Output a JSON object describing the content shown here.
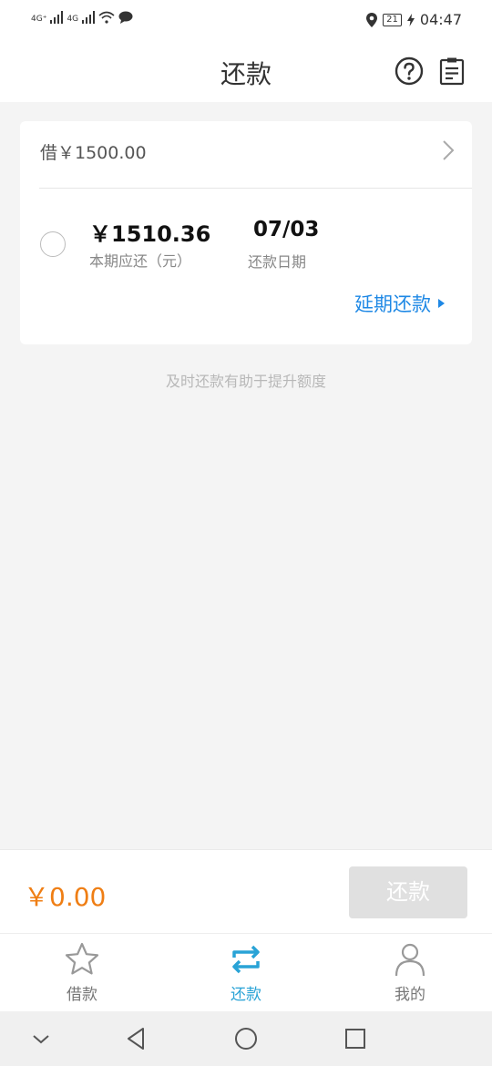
{
  "status_bar": {
    "network_1": "4G⁺",
    "network_2": "4G",
    "battery": "21",
    "time": "04:47"
  },
  "header": {
    "title": "还款",
    "help_icon": "question-circle-icon",
    "bill_icon": "clipboard-list-icon"
  },
  "loan_card": {
    "loan_label": "借￥1500.00",
    "amount_due": "￥1510.36",
    "amount_due_label": "本期应还（元）",
    "due_date": "07/03",
    "due_date_label": "还款日期",
    "extend_link": "延期还款"
  },
  "tip": "及时还款有助于提升额度",
  "pay_bar": {
    "total": "￥0.00",
    "button_label": "还款"
  },
  "tabs": [
    {
      "label": "借款",
      "icon": "star-icon",
      "active": false
    },
    {
      "label": "还款",
      "icon": "repeat-icon",
      "active": true
    },
    {
      "label": "我的",
      "icon": "person-icon",
      "active": false
    }
  ],
  "colors": {
    "accent_blue": "#1e88e5",
    "tab_active": "#29a3d6",
    "amount_orange": "#ef7e14"
  }
}
